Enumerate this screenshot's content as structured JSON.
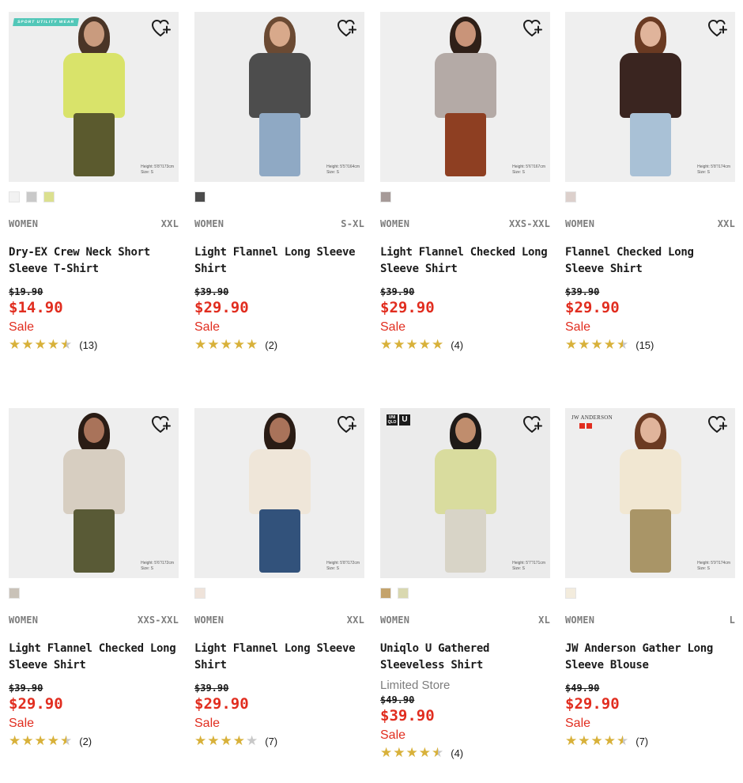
{
  "products": [
    {
      "gender": "WOMEN",
      "size": "XXL",
      "name": "Dry-EX Crew Neck Short Sleeve T-Shirt",
      "store": "",
      "original_price": "$19.90",
      "price": "$14.90",
      "sale": "Sale",
      "rating": 4.5,
      "reviews": "(13)",
      "swatches": [
        "#f2f2f2",
        "#c9c9c9",
        "#dbe08f"
      ],
      "badge": "SPORT UTILITY WEAR",
      "model_height": "Height: 5'8\"/173cm",
      "model_size": "Size: S",
      "colors": {
        "bg": "#eeeeee",
        "top": "#d9e36a",
        "bottom": "#5b5a2e",
        "hair": "#4a3527",
        "skin": "#c99b7e"
      }
    },
    {
      "gender": "WOMEN",
      "size": "S-XL",
      "name": "Light Flannel Long Sleeve Shirt",
      "store": "",
      "original_price": "$39.90",
      "price": "$29.90",
      "sale": "Sale",
      "rating": 5,
      "reviews": "(2)",
      "swatches": [
        "#4c4c4c"
      ],
      "badge": "",
      "model_height": "Height: 5'5\"/164cm",
      "model_size": "Size: S",
      "colors": {
        "bg": "#ededed",
        "top": "#4d4d4d",
        "bottom": "#8fa9c4",
        "hair": "#6b4a33",
        "skin": "#d8a98b"
      }
    },
    {
      "gender": "WOMEN",
      "size": "XXS-XXL",
      "name": "Light Flannel Checked Long Sleeve Shirt",
      "store": "",
      "original_price": "$39.90",
      "price": "$29.90",
      "sale": "Sale",
      "rating": 5,
      "reviews": "(4)",
      "swatches": [
        "#a69a98"
      ],
      "badge": "",
      "model_height": "Height: 5'6\"/167cm",
      "model_size": "Size: S",
      "colors": {
        "bg": "#efefef",
        "top": "#b4aaa6",
        "bottom": "#8e3f22",
        "hair": "#2f2018",
        "skin": "#c99479"
      }
    },
    {
      "gender": "WOMEN",
      "size": "XXL",
      "name": "Flannel Checked Long Sleeve Shirt",
      "store": "",
      "original_price": "$39.90",
      "price": "$29.90",
      "sale": "Sale",
      "rating": 4.5,
      "reviews": "(15)",
      "swatches": [
        "#dcd0cc"
      ],
      "badge": "",
      "model_height": "Height: 5'8\"/174cm",
      "model_size": "Size: S",
      "colors": {
        "bg": "#efefef",
        "top": "#3a2520",
        "bottom": "#a9c1d6",
        "hair": "#6a3a22",
        "skin": "#e0b49b"
      }
    },
    {
      "gender": "WOMEN",
      "size": "XXS-XXL",
      "name": "Light Flannel Checked Long Sleeve Shirt",
      "store": "",
      "original_price": "$39.90",
      "price": "$29.90",
      "sale": "Sale",
      "rating": 4.5,
      "reviews": "(2)",
      "swatches": [
        "#c9c2b8"
      ],
      "badge": "",
      "model_height": "Height: 5'6\"/172cm",
      "model_size": "Size: S",
      "colors": {
        "bg": "#eeeeee",
        "top": "#d7cec1",
        "bottom": "#595a36",
        "hair": "#2a1c15",
        "skin": "#a9735a"
      }
    },
    {
      "gender": "WOMEN",
      "size": "XXL",
      "name": "Light Flannel Long Sleeve Shirt",
      "store": "",
      "original_price": "$39.90",
      "price": "$29.90",
      "sale": "Sale",
      "rating": 4,
      "reviews": "(7)",
      "swatches": [
        "#efe3da"
      ],
      "badge": "",
      "model_height": "Height: 5'8\"/172cm",
      "model_size": "Size: S",
      "colors": {
        "bg": "#eeeeee",
        "top": "#efe6d9",
        "bottom": "#32527b",
        "hair": "#2a1c15",
        "skin": "#a9735a"
      }
    },
    {
      "gender": "WOMEN",
      "size": "XL",
      "name": "Uniqlo U Gathered Sleeveless Shirt",
      "store": "Limited Store",
      "original_price": "$49.90",
      "price": "$39.90",
      "sale": "Sale",
      "rating": 4.5,
      "reviews": "(4)",
      "swatches": [
        "#c4a36c",
        "#d9d8b0"
      ],
      "badge": "UNIQLO U",
      "model_height": "Height: 5'7\"/171cm",
      "model_size": "Size: S",
      "colors": {
        "bg": "#ebebeb",
        "top": "#d9dc9e",
        "bottom": "#d8d4c7",
        "hair": "#1e1a18",
        "skin": "#c08d6d"
      }
    },
    {
      "gender": "WOMEN",
      "size": "L",
      "name": "JW Anderson Gather Long Sleeve Blouse",
      "store": "",
      "original_price": "$49.90",
      "price": "$29.90",
      "sale": "Sale",
      "rating": 4.5,
      "reviews": "(7)",
      "swatches": [
        "#f3ecdd"
      ],
      "badge": "JW ANDERSON",
      "model_height": "Height: 5'9\"/174cm",
      "model_size": "Size: S",
      "colors": {
        "bg": "#eeeeee",
        "top": "#f1e7d2",
        "bottom": "#a99567",
        "hair": "#6b3a22",
        "skin": "#e0b49b"
      }
    }
  ]
}
